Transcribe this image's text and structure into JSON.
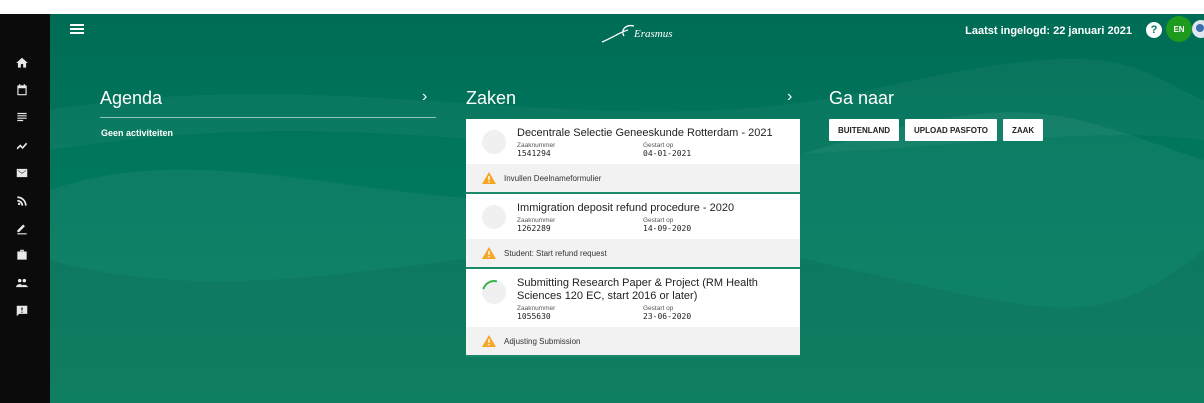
{
  "header": {
    "menu_icon": "hamburger-icon",
    "logo_text": "Erasmus",
    "last_login": "Laatst ingelogd: 22 januari 2021",
    "help_icon": "question-icon",
    "help_glyph": "?",
    "language": "EN",
    "avatar_icon": "user-avatar-icon"
  },
  "sidebar": {
    "items": [
      {
        "icon": "home-icon"
      },
      {
        "icon": "calendar-icon"
      },
      {
        "icon": "list-icon"
      },
      {
        "icon": "trend-icon"
      },
      {
        "icon": "mail-icon"
      },
      {
        "icon": "rss-icon"
      },
      {
        "icon": "edit-icon"
      },
      {
        "icon": "briefcase-icon"
      },
      {
        "icon": "group-icon"
      },
      {
        "icon": "feedback-icon"
      }
    ]
  },
  "agenda": {
    "title": "Agenda",
    "arrow": "›",
    "empty_text": "Geen activiteiten"
  },
  "zaken": {
    "title": "Zaken",
    "arrow": "›",
    "number_label": "Zaaknummer",
    "started_label": "Gestart op",
    "cases": [
      {
        "title": "Decentrale Selectie Geneeskunde Rotterdam - 2021",
        "number": "1541294",
        "started": "04-01-2021",
        "task": "Invullen Deelnameformulier",
        "in_progress": false
      },
      {
        "title": "Immigration deposit refund procedure - 2020",
        "number": "1262289",
        "started": "14-09-2020",
        "task": "Student: Start refund request",
        "in_progress": false
      },
      {
        "title": "Submitting Research Paper & Project (RM Health Sciences 120 EC, start 2016 or later)",
        "number": "1055630",
        "started": "23-06-2020",
        "task": "Adjusting Submission",
        "in_progress": true
      }
    ]
  },
  "goto": {
    "title": "Ga naar",
    "buttons": [
      "BUITENLAND",
      "UPLOAD PASFOTO",
      "ZAAK"
    ]
  },
  "colors": {
    "brand_green": "#00775d",
    "warning": "#f5a623",
    "language_badge": "#1e9b1e"
  }
}
